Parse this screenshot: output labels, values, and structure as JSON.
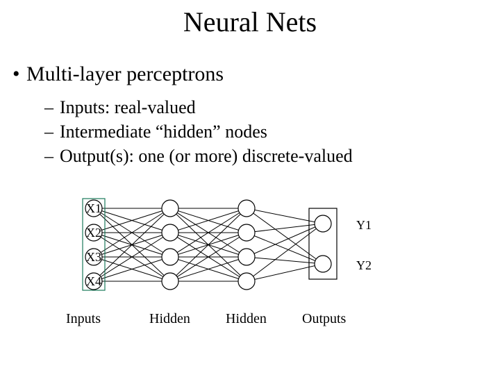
{
  "title": "Neural Nets",
  "bullet": "Multi-layer perceptrons",
  "subs": {
    "a": "Inputs: real-valued",
    "b": "Intermediate “hidden” nodes",
    "c": "Output(s): one (or more) discrete-valued"
  },
  "net": {
    "input_labels": [
      "X1",
      "X2",
      "X3",
      "X4"
    ],
    "output_labels": [
      "Y1",
      "Y2"
    ],
    "column_labels": [
      "Inputs",
      "Hidden",
      "Hidden",
      "Outputs"
    ],
    "layer_sizes": [
      4,
      4,
      4,
      2
    ]
  }
}
